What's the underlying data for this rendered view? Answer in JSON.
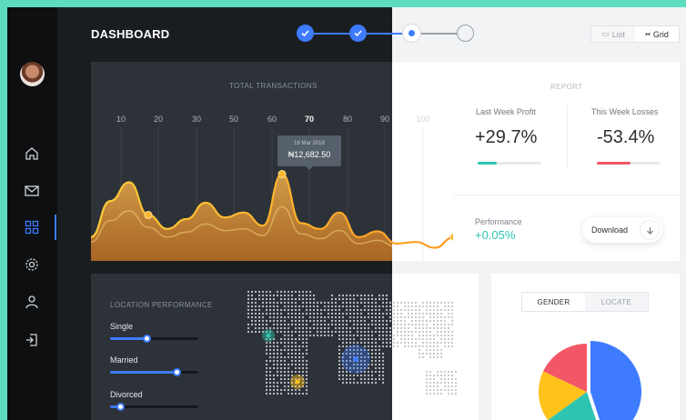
{
  "header": {
    "title": "DASHBOARD",
    "stepper": {
      "total_steps": 4,
      "completed_steps": 2,
      "current_step": 3
    },
    "view_toggle": {
      "list_label": "List",
      "grid_label": "Grid",
      "selected": "Grid"
    }
  },
  "sidebar": {
    "items": [
      {
        "name": "home",
        "icon": "home-icon"
      },
      {
        "name": "messages",
        "icon": "mail-icon"
      },
      {
        "name": "dashboard",
        "icon": "grid-icon",
        "active": true
      },
      {
        "name": "settings",
        "icon": "gear-icon"
      },
      {
        "name": "profile",
        "icon": "user-icon"
      },
      {
        "name": "logout",
        "icon": "logout-icon"
      }
    ]
  },
  "transactions": {
    "caption": "TOTAL TRANSACTIONS",
    "tooltip_date": "16 Mar 2018",
    "tooltip_amount": "₦12,682.50",
    "highlighted_tick": "70"
  },
  "chart_data": {
    "type": "area",
    "title": "TOTAL TRANSACTIONS",
    "x_ticks": [
      "10",
      "20",
      "30",
      "50",
      "60",
      "70",
      "80",
      "90",
      "100"
    ],
    "x": [
      0,
      5,
      10,
      15,
      20,
      25,
      30,
      35,
      40,
      45,
      50,
      55,
      60,
      65,
      70,
      75,
      80,
      85,
      90,
      95
    ],
    "series": [
      {
        "values": [
          18,
          62,
          85,
          45,
          28,
          40,
          60,
          42,
          48,
          32,
          95,
          35,
          28,
          48,
          18,
          25,
          10,
          12,
          5,
          18
        ]
      },
      {
        "values": [
          12,
          38,
          50,
          30,
          18,
          24,
          34,
          26,
          28,
          20,
          55,
          22,
          16,
          26,
          10,
          14,
          6,
          8,
          3,
          10
        ]
      }
    ],
    "ylim": [
      0,
      110
    ],
    "colors": {
      "line": "#ffce3a",
      "line_end": "#ff9a1f",
      "fill_top": "#d9a24a",
      "fill_bottom": "#b86b22"
    }
  },
  "report": {
    "caption": "REPORT",
    "profit_label": "Last Week Profit",
    "profit_value": "+29.7%",
    "profit_progress": 0.3,
    "loss_label": "This Week Losses",
    "loss_value": "-53.4%",
    "loss_progress": 0.53,
    "performance_label": "Performance",
    "performance_value": "+0.05%",
    "download_label": "Download",
    "colors": {
      "profit": "#2ec5b0",
      "loss": "#f25767"
    }
  },
  "location": {
    "caption": "LOCATION PERFORMANCE",
    "sliders": [
      {
        "label": "Single",
        "value": 0.42
      },
      {
        "label": "Married",
        "value": 0.76
      },
      {
        "label": "Divorced",
        "value": 0.12
      }
    ]
  },
  "gender": {
    "tabs": [
      {
        "label": "GENDER",
        "active": true
      },
      {
        "label": "LOCATE",
        "active": false
      }
    ],
    "pie": [
      {
        "value": 0.45,
        "color": "#3e7bff"
      },
      {
        "value": 0.2,
        "color": "#2ec5b0"
      },
      {
        "value": 0.17,
        "color": "#ffc21a"
      },
      {
        "value": 0.18,
        "color": "#f25767"
      }
    ]
  },
  "colors": {
    "accent": "#3e7bff",
    "background": "#5ddcc0"
  }
}
